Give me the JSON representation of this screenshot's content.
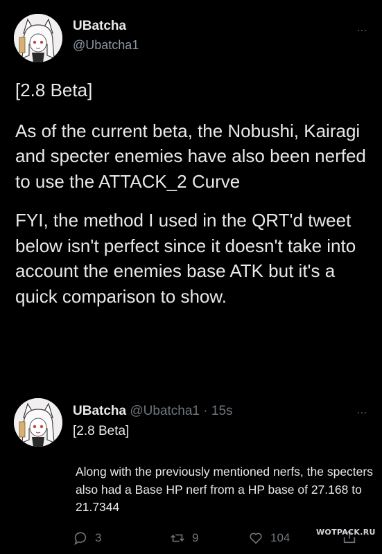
{
  "tweet": {
    "author_name": "UBatcha",
    "author_handle": "@Ubatcha1",
    "body": {
      "p1": "[2.8 Beta]",
      "p2": "As of the current beta, the Nobushi, Kairagi and specter enemies have also been nerfed to use the ATTACK_2 Curve",
      "p3": "FYI, the method I used in the QRT'd tweet below isn't perfect since it doesn't take into account the enemies base ATK but it's a quick comparison to show."
    },
    "more_icon": "…"
  },
  "quoted_tweet": {
    "author_name": "UBatcha",
    "author_handle": "@Ubatcha1",
    "separator": " · ",
    "time": "15s",
    "line1": "[2.8 Beta]",
    "line2": "Along with the previously mentioned nerfs, the specters also had a Base HP nerf from a HP base of 27.168 to 21.7344",
    "more_icon": "…"
  },
  "actions": {
    "replies": "3",
    "retweets": "9",
    "likes": "104"
  },
  "watermark": "WOTPACK.RU",
  "colors": {
    "background": "#000000",
    "text": "#e7e9ea",
    "muted": "#6e767d"
  }
}
